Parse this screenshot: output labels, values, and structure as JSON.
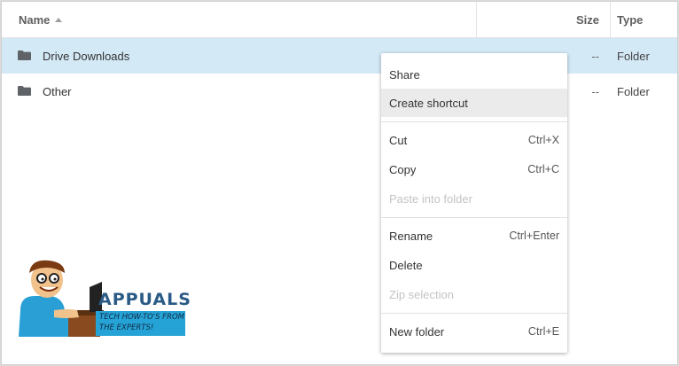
{
  "header": {
    "name_label": "Name",
    "size_label": "Size",
    "type_label": "Type"
  },
  "rows": [
    {
      "name": "Drive Downloads",
      "size": "--",
      "type": "Folder",
      "icon": "folder-icon",
      "selected": true
    },
    {
      "name": "Other",
      "size": "--",
      "type": "Folder",
      "icon": "folder-icon",
      "selected": false
    }
  ],
  "context_menu": {
    "share": "Share",
    "create_shortcut": "Create shortcut",
    "cut": "Cut",
    "cut_shortcut": "Ctrl+X",
    "copy": "Copy",
    "copy_shortcut": "Ctrl+C",
    "paste_into_folder": "Paste into folder",
    "rename": "Rename",
    "rename_shortcut": "Ctrl+Enter",
    "delete": "Delete",
    "zip_selection": "Zip selection",
    "new_folder": "New folder",
    "new_folder_shortcut": "Ctrl+E"
  },
  "watermark": {
    "title": "APPUALS",
    "line1": "TECH HOW-TO'S FROM",
    "line2": "THE EXPERTS!"
  },
  "colors": {
    "selection": "#d3e9f6",
    "menu_hover": "#ebebeb",
    "logo_blue": "#26a3d6"
  }
}
